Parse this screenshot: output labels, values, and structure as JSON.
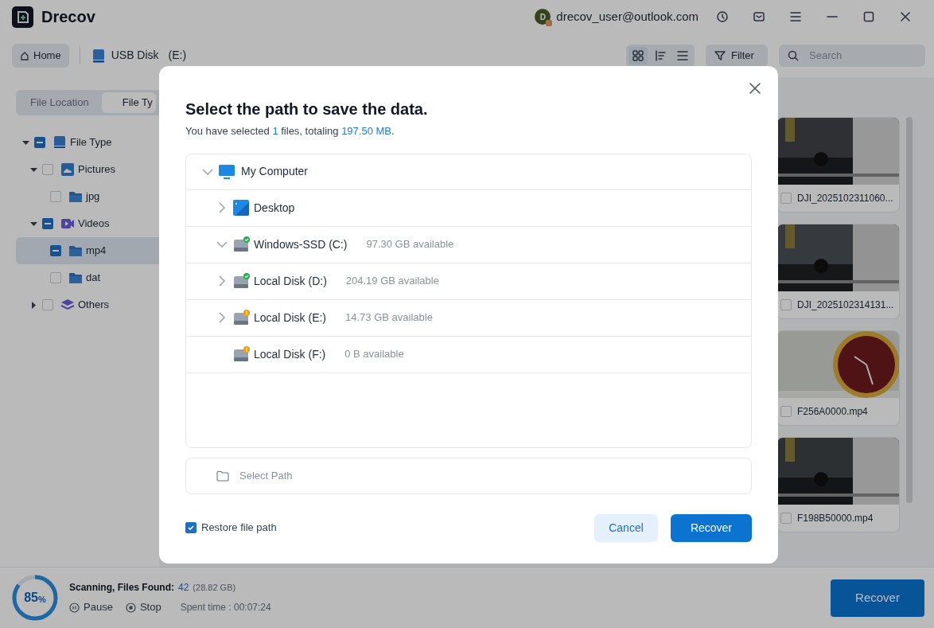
{
  "app": {
    "title": "Drecov",
    "account": {
      "initial": "D",
      "email": "drecov_user@outlook.com"
    }
  },
  "toolbar": {
    "home": "Home",
    "location": {
      "name": "USB Disk",
      "drive": "(E:)"
    },
    "views": [
      {
        "kind": "grid",
        "selected": true
      },
      {
        "kind": "sort",
        "selected": false
      },
      {
        "kind": "list",
        "selected": false
      }
    ],
    "filter": "Filter",
    "search": {
      "placeholder": "Search"
    }
  },
  "sidebar": {
    "tabs": [
      {
        "label": "File Location",
        "selected": false
      },
      {
        "label": "File Ty",
        "selected": true
      }
    ],
    "tree": [
      {
        "label": "File Type",
        "kind": "drive",
        "mixed": true,
        "expanded": true,
        "selected": false,
        "children": [
          {
            "label": "Pictures",
            "kind": "pictures",
            "mixed": false,
            "expanded": true,
            "selected": false,
            "children": [
              {
                "label": "jpg",
                "kind": "folder",
                "mixed": false,
                "selected": false
              }
            ]
          },
          {
            "label": "Videos",
            "kind": "videos",
            "mixed": true,
            "expanded": true,
            "selected": false,
            "children": [
              {
                "label": "mp4",
                "kind": "folder",
                "mixed": true,
                "selected": true
              },
              {
                "label": "dat",
                "kind": "folder",
                "mixed": false,
                "selected": false
              }
            ]
          },
          {
            "label": "Others",
            "kind": "layers",
            "mixed": false,
            "expanded": false,
            "selected": false
          }
        ]
      }
    ]
  },
  "files": [
    {
      "name": "DJI_2025102311060...",
      "checked": false,
      "kind": "picture"
    },
    {
      "name": "DJI_2025102314131...",
      "checked": false,
      "kind": "picture"
    },
    {
      "name": "F256A0000.mp4",
      "checked": false,
      "kind": "picture"
    },
    {
      "name": "F198B50000.mp4",
      "checked": false,
      "kind": "picture"
    }
  ],
  "status_bar": {
    "progress": {
      "level": 0.85,
      "value": "85",
      "unit": "%"
    },
    "label": "Scanning, Files Found:",
    "count": "42",
    "size": "(28.82 GB)",
    "pause": "Pause",
    "stop": "Stop",
    "spent_time": "Spent time : 00:07:24",
    "recover": "Recover"
  },
  "dialog": {
    "title": "Select the path to save the data.",
    "summary": [
      {
        "text": "You have selected ",
        "kind": "plain"
      },
      {
        "text": "1",
        "kind": "value"
      },
      {
        "text": " files, totaling ",
        "kind": "plain"
      },
      {
        "text": "197.50 MB",
        "kind": "value"
      },
      {
        "text": ".",
        "kind": "plain"
      }
    ],
    "tree": {
      "label": "My Computer",
      "kind": "computer",
      "expanded": true,
      "children": [
        {
          "label": "Desktop",
          "kind": "desktop",
          "expanded": false
        },
        {
          "label": "Windows-SSD (C:)",
          "kind": "drive",
          "warning": false,
          "available": "97.30 GB available",
          "expanded": true
        },
        {
          "label": "Local Disk (D:)",
          "kind": "drive",
          "warning": false,
          "available": "204.19 GB available",
          "expanded": false
        },
        {
          "label": "Local Disk (E:)",
          "kind": "drive",
          "warning": true,
          "available": "14.73 GB available",
          "expanded": false
        },
        {
          "label": "Local Disk (F:)",
          "kind": "drive",
          "warning": true,
          "available": "0 B available"
        }
      ]
    },
    "path_field": {
      "placeholder": "Select Path"
    },
    "restore_path": {
      "label": "Restore file path",
      "checked": true
    },
    "buttons": [
      {
        "label": "Cancel",
        "kind": "secondary"
      },
      {
        "label": "Recover",
        "kind": "primary"
      }
    ]
  }
}
